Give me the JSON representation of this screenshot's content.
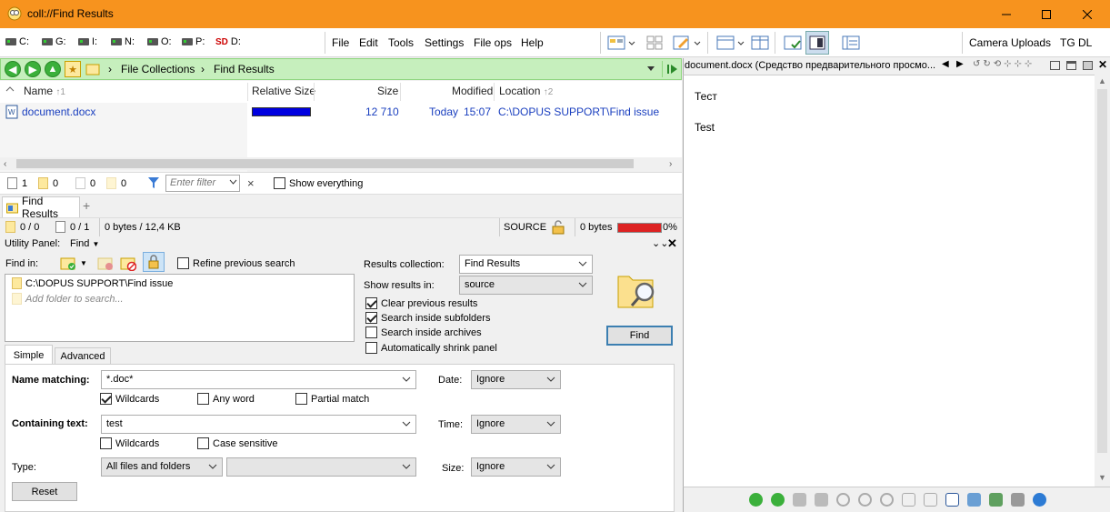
{
  "window": {
    "title": "coll://Find Results",
    "minimize_label": "—",
    "maximize_label": "☐",
    "close_label": "✕"
  },
  "toolbar": {
    "drives": [
      "C:",
      "G:",
      "I:",
      "N:",
      "O:",
      "P:",
      "D:"
    ],
    "menus": [
      "File",
      "Edit",
      "Tools",
      "Settings",
      "File ops",
      "Help"
    ],
    "right_buttons": [
      "Camera Uploads",
      "TG DL"
    ]
  },
  "pathbar": {
    "crumbs": [
      "File Collections",
      "Find Results"
    ]
  },
  "filelist": {
    "columns": {
      "name": "Name",
      "name_sort": "↑1",
      "relsize": "Relative Size",
      "size": "Size",
      "modified": "Modified",
      "location": "Location",
      "location_sort": "↑2"
    },
    "rows": [
      {
        "name": "document.docx",
        "relsize_fraction": 1.0,
        "size": "12 710",
        "modified_day": "Today",
        "modified_time": "15:07",
        "location": "C:\\DOPUS SUPPORT\\Find issue"
      }
    ]
  },
  "statusbar1": {
    "files_count": "1",
    "folders_count": "0",
    "sel_files": "0",
    "sel_folders": "0",
    "filter_placeholder": "Enter filter",
    "show_everything": "Show everything"
  },
  "tabs": {
    "active_tab": "Find Results",
    "add_tab": "+"
  },
  "statusbar2": {
    "dirs": "0 / 0",
    "files": "0 / 1",
    "bytes": "0 bytes / 12,4 KB",
    "source": "SOURCE",
    "free_bytes": "0 bytes",
    "percent": "0%"
  },
  "utility": {
    "panel_label": "Utility Panel:",
    "mode": "Find",
    "find_in_label": "Find in:",
    "refine_label": "Refine previous search",
    "find_in_items": [
      "C:\\DOPUS SUPPORT\\Find issue"
    ],
    "add_folder_placeholder": "Add folder to search...",
    "results_collection_label": "Results collection:",
    "results_collection_value": "Find Results",
    "show_results_label": "Show results in:",
    "show_results_value": "source",
    "options": [
      {
        "label": "Clear previous results",
        "checked": true
      },
      {
        "label": "Search inside subfolders",
        "checked": true
      },
      {
        "label": "Search inside archives",
        "checked": false
      },
      {
        "label": "Automatically shrink panel",
        "checked": false
      }
    ],
    "find_button": "Find",
    "tab_simple": "Simple",
    "tab_advanced": "Advanced",
    "name_matching_label": "Name matching:",
    "name_matching_value": "*.doc*",
    "name_wildcards": "Wildcards",
    "name_anyword": "Any word",
    "name_partial": "Partial match",
    "containing_label": "Containing text:",
    "containing_value": "test",
    "text_wildcards": "Wildcards",
    "text_case": "Case sensitive",
    "type_label": "Type:",
    "type_value": "All files and folders",
    "type_sub_value": "",
    "date_label": "Date:",
    "date_value": "Ignore",
    "time_label": "Time:",
    "time_value": "Ignore",
    "size_label": "Size:",
    "size_value": "Ignore",
    "reset_button": "Reset"
  },
  "viewer": {
    "title": "document.docx (Средство предварительного просмо...",
    "lines": [
      "Тест",
      "Test"
    ]
  },
  "colors": {
    "titlebar": "#f7931e",
    "pathbar": "#c6efbd",
    "link": "#1a3fbf",
    "relsize_bar": "#0000e0",
    "free_bar": "#dd2222"
  }
}
